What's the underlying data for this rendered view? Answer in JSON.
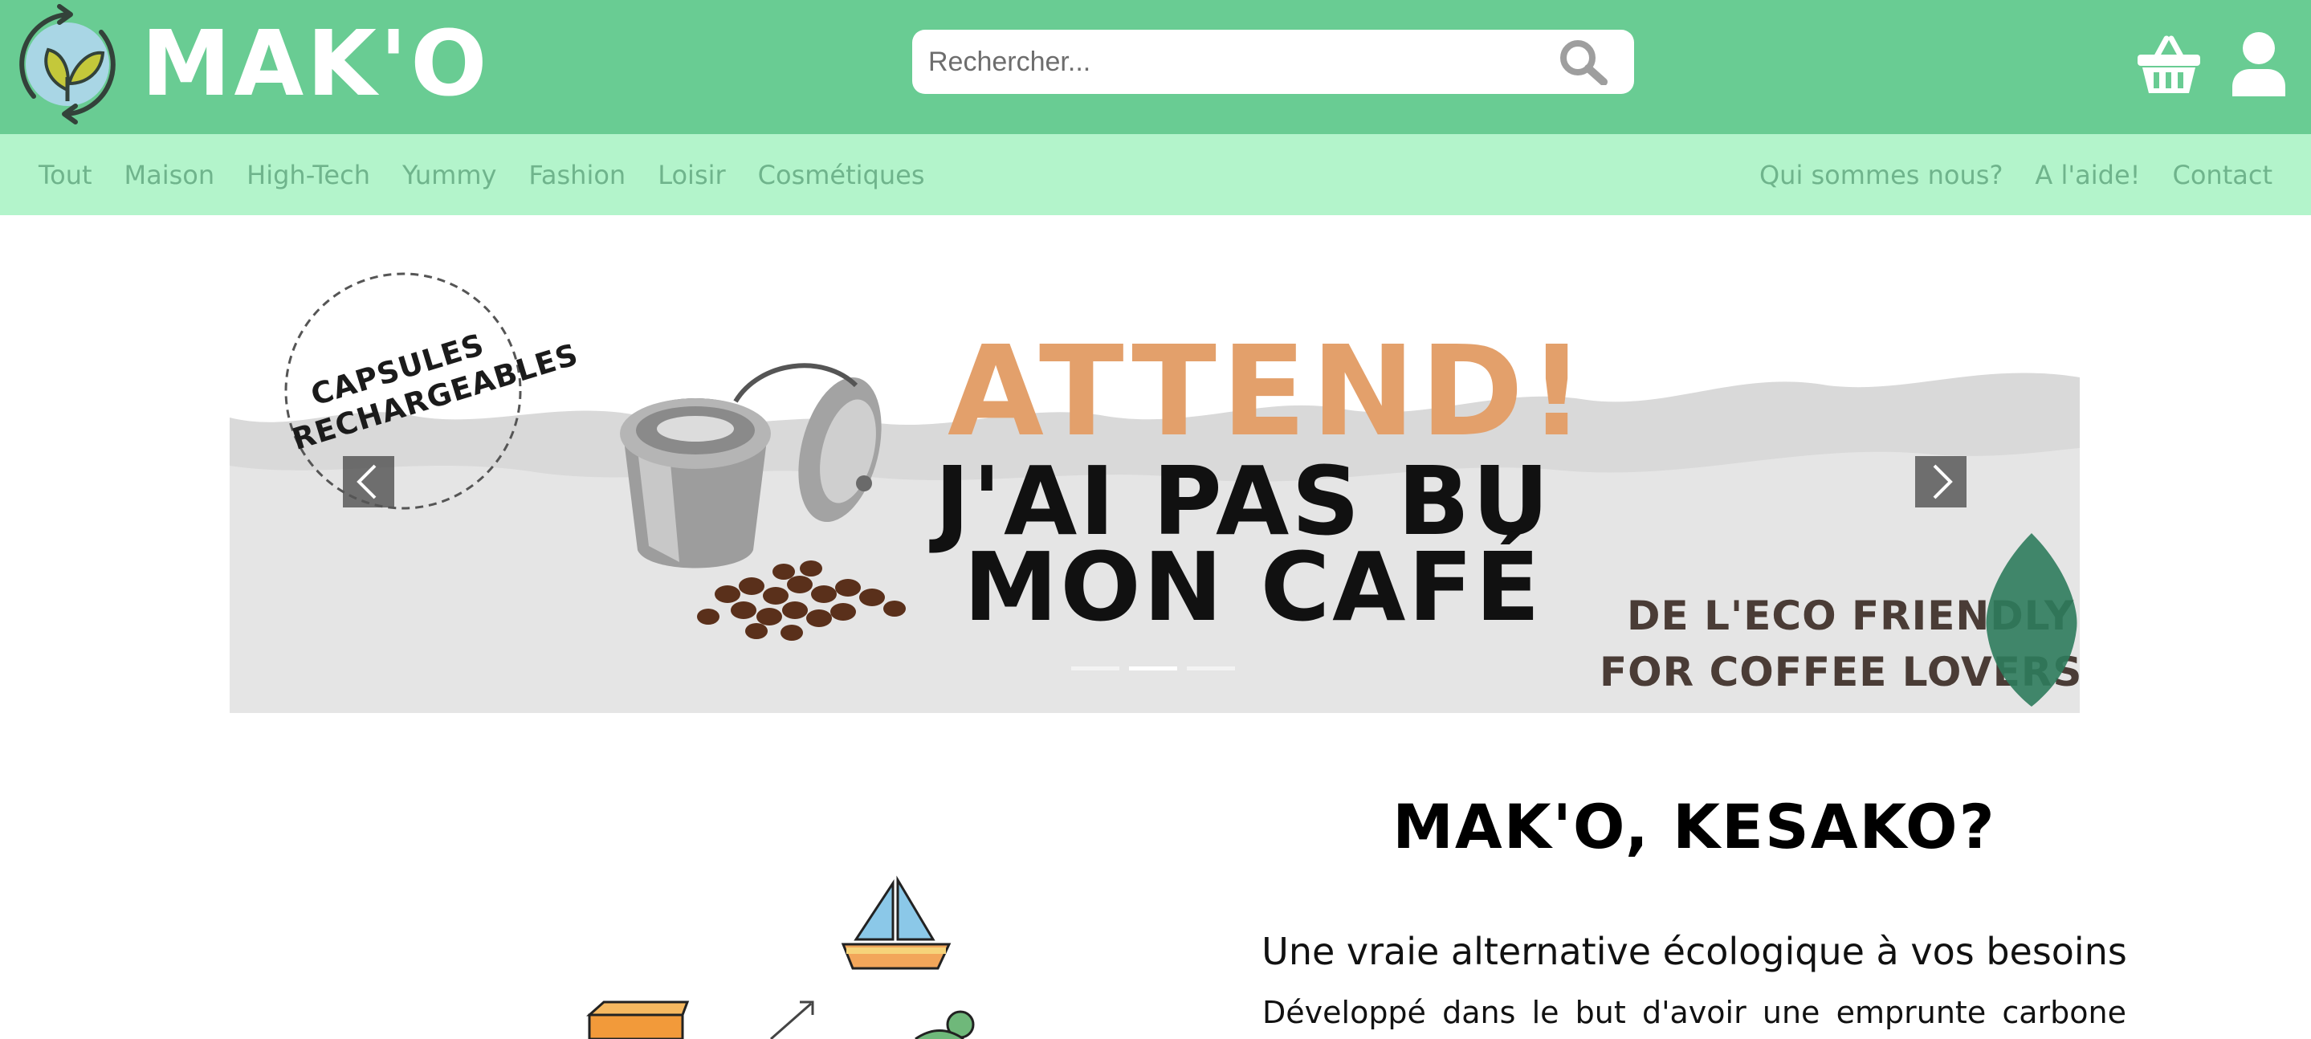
{
  "brand": {
    "name": "MAK'O",
    "logo_icon": "leaf-recycle-logo"
  },
  "header": {
    "search": {
      "placeholder": "Rechercher...",
      "icon": "search-icon"
    },
    "cart_icon": "basket-icon",
    "account_icon": "user-icon"
  },
  "nav": {
    "categories": [
      {
        "label": "Tout"
      },
      {
        "label": "Maison"
      },
      {
        "label": "High-Tech"
      },
      {
        "label": "Yummy"
      },
      {
        "label": "Fashion"
      },
      {
        "label": "Loisir"
      },
      {
        "label": "Cosmétiques"
      }
    ],
    "pages": [
      {
        "label": "Qui sommes nous?"
      },
      {
        "label": "A l'aide!"
      },
      {
        "label": "Contact"
      }
    ]
  },
  "carousel": {
    "slide": {
      "stamp": "CAPSULES RECHARGEABLES",
      "headline_1": "ATTEND!",
      "headline_2": "J'AI PAS BU",
      "headline_3": "MON CAFÉ",
      "tagline_1": "DE L'ECO FRIENDLY",
      "tagline_2": "FOR COFFEE LOVERS"
    },
    "slide_count": 3,
    "active_index": 1
  },
  "about": {
    "title": "MAK'O, KESAKO?",
    "subtitle": "Une vraie alternative écologique à vos besoins",
    "text": "Développé dans le but d'avoir une emprunte carbone"
  },
  "colors": {
    "header_green": "#69cc93",
    "nav_mint": "#b3f4cb",
    "nav_text": "#6fb48c",
    "accent_orange": "#e3a06b"
  }
}
